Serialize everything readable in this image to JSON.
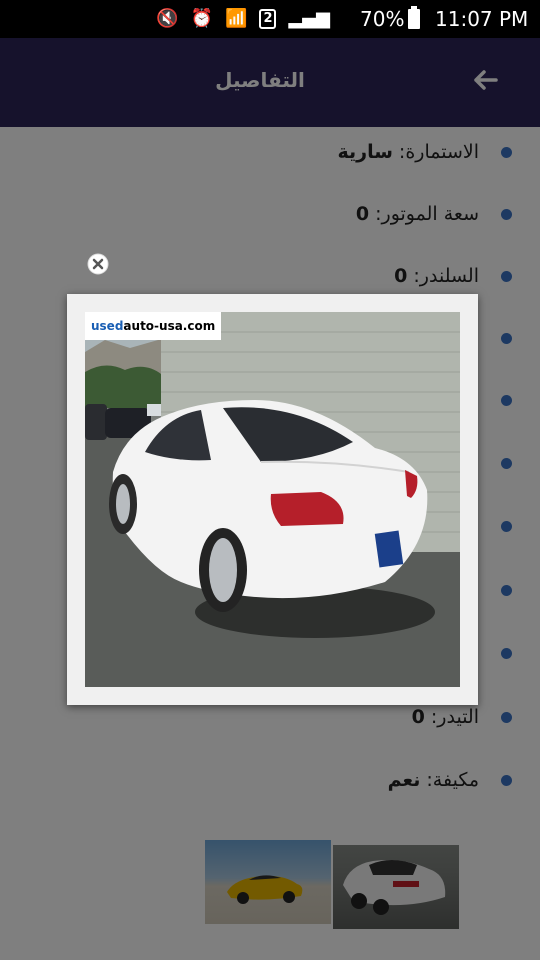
{
  "status_bar": {
    "signal_badge": "2",
    "battery": "70%",
    "time": "11:07 PM"
  },
  "header": {
    "title": "التفاصيل",
    "back_icon": "arrow-left-icon"
  },
  "details": [
    {
      "label": "الاستمارة:",
      "value": "سارية"
    },
    {
      "label": "سعة الموتور:",
      "value": "0"
    },
    {
      "label": "السلندر:",
      "value": "0"
    },
    {
      "label": "التيدر:",
      "value": "0"
    },
    {
      "label": "مكيفة:",
      "value": "نعم"
    }
  ],
  "popup": {
    "close_icon": "close-circle-icon",
    "watermark": {
      "part1": "used",
      "part2": "auto-usa.com"
    }
  },
  "colors": {
    "header_bg": "#2c2458",
    "bullet": "#3b73c4",
    "overlay": "rgba(0,0,0,0.5)"
  }
}
